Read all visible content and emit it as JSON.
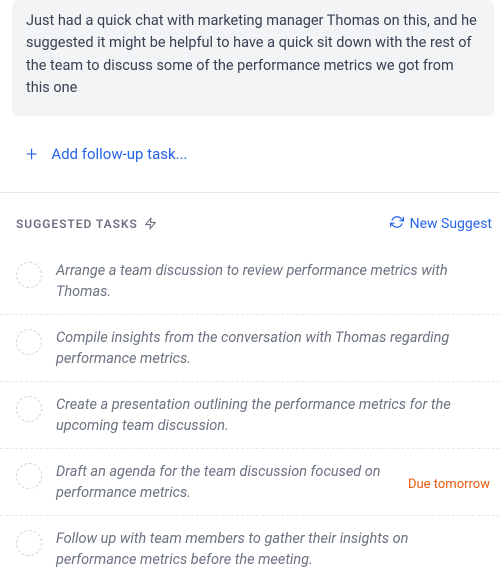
{
  "note": {
    "text": "Just had a quick chat with marketing manager Thomas on this, and he suggested it might be helpful to have a quick sit down with the rest of the team to discuss some of the performance metrics we got from this one"
  },
  "add_followup": {
    "label": "Add follow-up task..."
  },
  "suggested": {
    "title": "SUGGESTED TASKS",
    "refresh_label": "New Suggest",
    "items": [
      {
        "text": "Arrange a team discussion to review performance metrics with Thomas.",
        "meta": ""
      },
      {
        "text": "Compile insights from the conversation with Thomas regarding performance metrics.",
        "meta": ""
      },
      {
        "text": "Create a presentation outlining the performance metrics for the upcoming team discussion.",
        "meta": ""
      },
      {
        "text": "Draft an agenda for the team discussion focused on performance metrics.",
        "meta": "Due tomorrow"
      },
      {
        "text": "Follow up with team members to gather their insights on performance metrics before the meeting.",
        "meta": ""
      }
    ]
  }
}
